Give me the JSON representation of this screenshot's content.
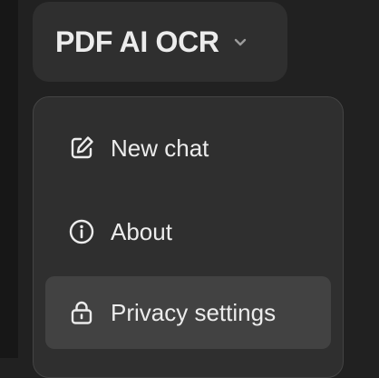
{
  "header": {
    "title": "PDF AI OCR",
    "chevron_icon": "chevron-down-icon"
  },
  "menu": {
    "items": [
      {
        "label": "New chat",
        "icon": "edit-icon"
      },
      {
        "label": "About",
        "icon": "info-icon"
      },
      {
        "label": "Privacy settings",
        "icon": "lock-icon",
        "highlighted": true
      }
    ]
  },
  "colors": {
    "background": "#212121",
    "surface": "#2f2f2f",
    "hover": "#424242",
    "text": "#ececec"
  }
}
